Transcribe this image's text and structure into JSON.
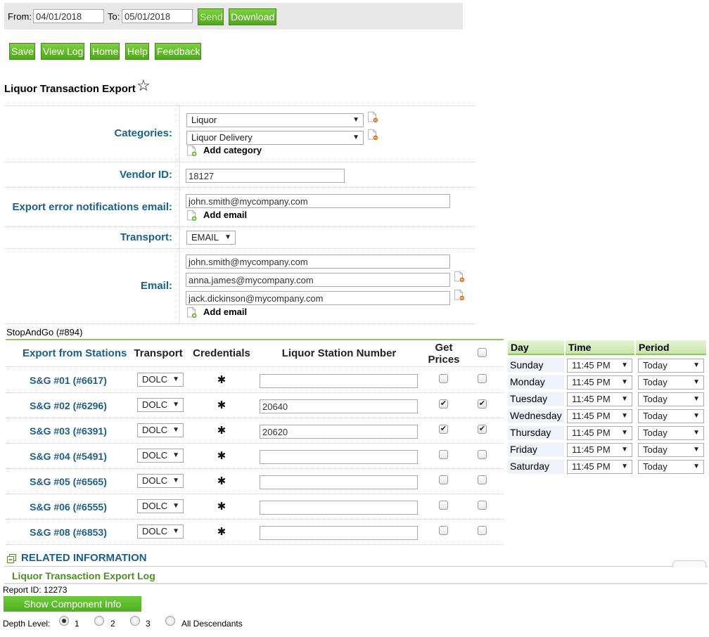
{
  "topbar": {
    "from_label": "From:",
    "from_value": "04/01/2018",
    "to_label": "To:",
    "to_value": "05/01/2018",
    "send": "Send",
    "download": "Download"
  },
  "toolbar": {
    "save": "Save",
    "view_log": "View Log",
    "home": "Home",
    "help": "Help",
    "feedback": "Feedback"
  },
  "page_title": "Liquor Transaction Export",
  "form": {
    "categories_label": "Categories:",
    "categories": [
      "Liquor",
      "Liquor Delivery"
    ],
    "add_category": "Add category",
    "vendor_label": "Vendor ID:",
    "vendor_value": "18127",
    "error_email_label": "Export error notifications email:",
    "error_email_value": "john.smith@mycompany.com",
    "add_email": "Add email",
    "transport_label": "Transport:",
    "transport_value": "EMAIL",
    "email_label": "Email:",
    "emails": [
      "john.smith@mycompany.com",
      "anna.james@mycompany.com",
      "jack.dickinson@mycompany.com"
    ]
  },
  "group_name": "StopAndGo (#894)",
  "stations_table": {
    "headers": {
      "station": "Export from Stations",
      "transport": "Transport",
      "credentials": "Credentials",
      "number": "Liquor Station Number",
      "get_prices": "Get Prices"
    },
    "rows": [
      {
        "station": "S&G #01 (#6617)",
        "transport": "DOLC",
        "number": "",
        "get_prices": false,
        "selected": false
      },
      {
        "station": "S&G #02 (#6296)",
        "transport": "DOLC",
        "number": "20640",
        "get_prices": true,
        "selected": true
      },
      {
        "station": "S&G #03 (#6391)",
        "transport": "DOLC",
        "number": "20620",
        "get_prices": true,
        "selected": true
      },
      {
        "station": "S&G #04 (#5491)",
        "transport": "DOLC",
        "number": "",
        "get_prices": false,
        "selected": false
      },
      {
        "station": "S&G #05 (#6565)",
        "transport": "DOLC",
        "number": "",
        "get_prices": false,
        "selected": false
      },
      {
        "station": "S&G #06 (#6555)",
        "transport": "DOLC",
        "number": "",
        "get_prices": false,
        "selected": false
      },
      {
        "station": "S&G #08 (#6853)",
        "transport": "DOLC",
        "number": "",
        "get_prices": false,
        "selected": false
      }
    ]
  },
  "schedule": {
    "headers": {
      "day": "Day",
      "time": "Time",
      "period": "Period"
    },
    "rows": [
      {
        "day": "Sunday",
        "time": "11:45 PM",
        "period": "Today"
      },
      {
        "day": "Monday",
        "time": "11:45 PM",
        "period": "Today"
      },
      {
        "day": "Tuesday",
        "time": "11:45 PM",
        "period": "Today"
      },
      {
        "day": "Wednesday",
        "time": "11:45 PM",
        "period": "Today"
      },
      {
        "day": "Thursday",
        "time": "11:45 PM",
        "period": "Today"
      },
      {
        "day": "Friday",
        "time": "11:45 PM",
        "period": "Today"
      },
      {
        "day": "Saturday",
        "time": "11:45 PM",
        "period": "Today"
      }
    ]
  },
  "related": {
    "header": "RELATED INFORMATION",
    "log_link": "Liquor Transaction Export Log",
    "report_id": "Report ID: 12273",
    "show_component": "Show Component Info",
    "depth_label": "Depth Level:",
    "depth_options": [
      "1",
      "2",
      "3",
      "All Descendants"
    ],
    "depth_selected": "1"
  },
  "colors": {
    "accent_green": "#5cb82a",
    "label_blue": "#1a5f8e",
    "link_green": "#4e8f22"
  }
}
